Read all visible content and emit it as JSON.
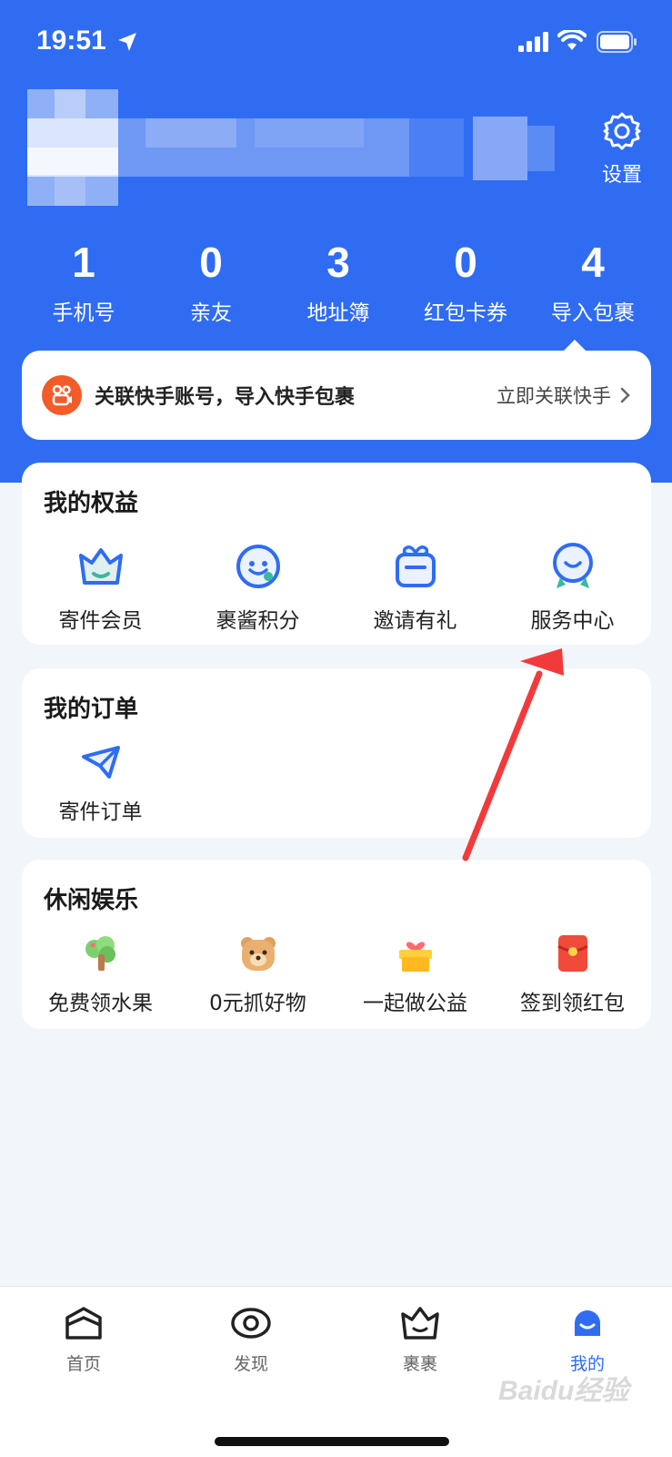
{
  "status_bar": {
    "time": "19:51"
  },
  "header": {
    "settings_label": "设置"
  },
  "stats": [
    {
      "value": "1",
      "label": "手机号"
    },
    {
      "value": "0",
      "label": "亲友"
    },
    {
      "value": "3",
      "label": "地址簿"
    },
    {
      "value": "0",
      "label": "红包卡券"
    },
    {
      "value": "4",
      "label": "导入包裹"
    }
  ],
  "banner": {
    "text": "关联快手账号，导入快手包裹",
    "action": "立即关联快手"
  },
  "benefits": {
    "title": "我的权益",
    "items": [
      {
        "label": "寄件会员",
        "icon": "crown-icon"
      },
      {
        "label": "裹酱积分",
        "icon": "smiley-icon"
      },
      {
        "label": "邀请有礼",
        "icon": "gift-icon"
      },
      {
        "label": "服务中心",
        "icon": "service-icon"
      }
    ]
  },
  "orders": {
    "title": "我的订单",
    "items": [
      {
        "label": "寄件订单",
        "icon": "paper-plane-icon"
      }
    ]
  },
  "leisure": {
    "title": "休闲娱乐",
    "items": [
      {
        "label": "免费领水果",
        "icon": "tree-icon"
      },
      {
        "label": "0元抓好物",
        "icon": "bear-icon"
      },
      {
        "label": "一起做公益",
        "icon": "charity-box-icon"
      },
      {
        "label": "签到领红包",
        "icon": "red-envelope-icon"
      }
    ]
  },
  "tabbar": {
    "tabs": [
      {
        "label": "首页",
        "icon": "home-icon"
      },
      {
        "label": "发现",
        "icon": "eye-icon"
      },
      {
        "label": "裹裹",
        "icon": "crown-icon"
      },
      {
        "label": "我的",
        "icon": "user-icon",
        "active": true
      }
    ]
  },
  "watermark": "Baidu经验",
  "colors": {
    "primary": "#2f6cf2",
    "accent_red": "#f23a3a",
    "kuaishou": "#f25c28"
  }
}
